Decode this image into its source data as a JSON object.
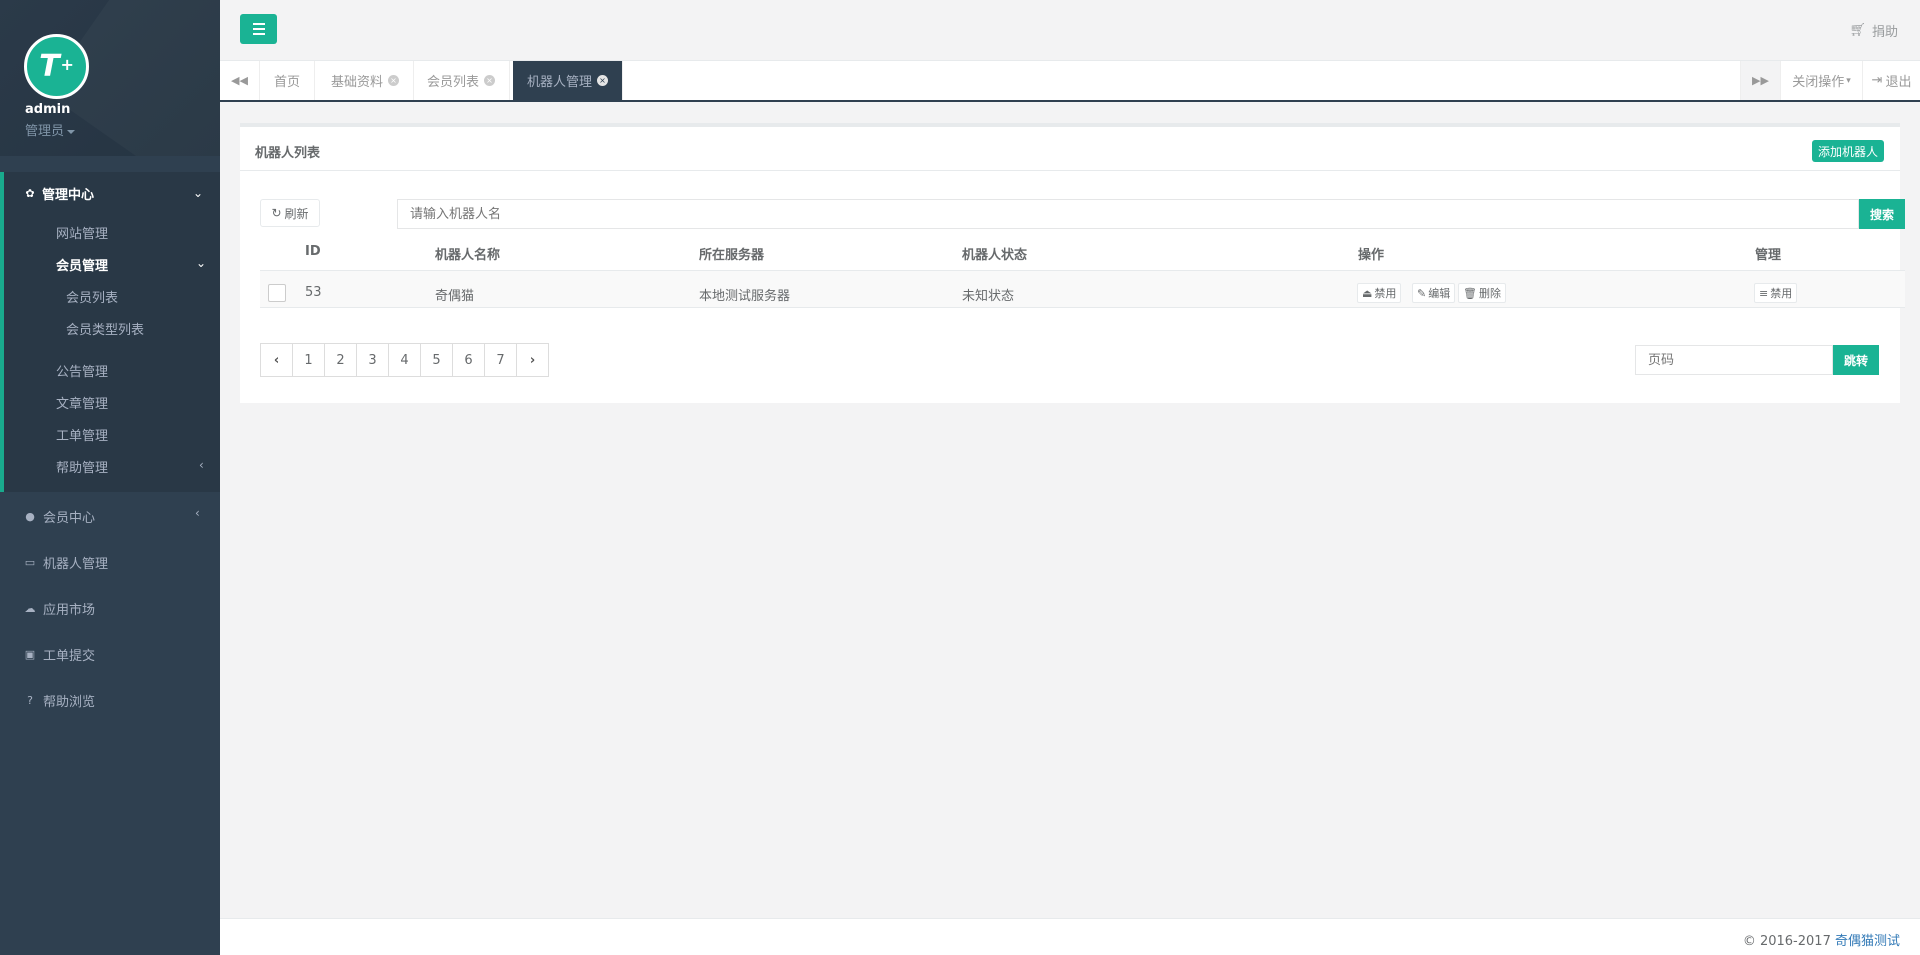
{
  "sidebar": {
    "avatar_text": "T",
    "avatar_plus": "+",
    "username": "admin",
    "role": "管理员",
    "admin_center": "管理中心",
    "sub_items": [
      "网站管理",
      "会员管理",
      "会员列表",
      "会员类型列表",
      "公告管理",
      "文章管理",
      "工单管理",
      "帮助管理"
    ],
    "main_items": [
      "会员中心",
      "机器人管理",
      "应用市场",
      "工单提交",
      "帮助浏览"
    ],
    "accent_color": "#19aa8d"
  },
  "topbar": {
    "donate": "捐助"
  },
  "tabs": {
    "items": [
      "首页",
      "基础资料",
      "会员列表",
      "机器人管理"
    ],
    "active": "机器人管理",
    "close_ops": "关闭操作",
    "logout": "退出"
  },
  "card": {
    "title": "机器人列表",
    "add_button": "添加机器人",
    "refresh": "刷新",
    "search_placeholder": "请输入机器人名",
    "search_button": "搜索"
  },
  "table": {
    "headers": [
      "ID",
      "机器人名称",
      "所在服务器",
      "机器人状态",
      "操作",
      "管理"
    ],
    "rows": [
      {
        "id": "53",
        "name": "奇偶猫",
        "server": "本地测试服务器",
        "status": "未知状态",
        "actions": [
          "禁用",
          "编辑",
          "删除"
        ],
        "manage": "禁用"
      }
    ]
  },
  "pagination": {
    "pages": [
      "1",
      "2",
      "3",
      "4",
      "5",
      "6",
      "7"
    ],
    "page_placeholder": "页码",
    "jump_button": "跳转"
  },
  "footer": {
    "copyright": "© 2016-2017",
    "link": "奇偶猫测试"
  },
  "colors": {
    "primary": "#1ab394",
    "sidebar_bg": "#2f4050"
  }
}
